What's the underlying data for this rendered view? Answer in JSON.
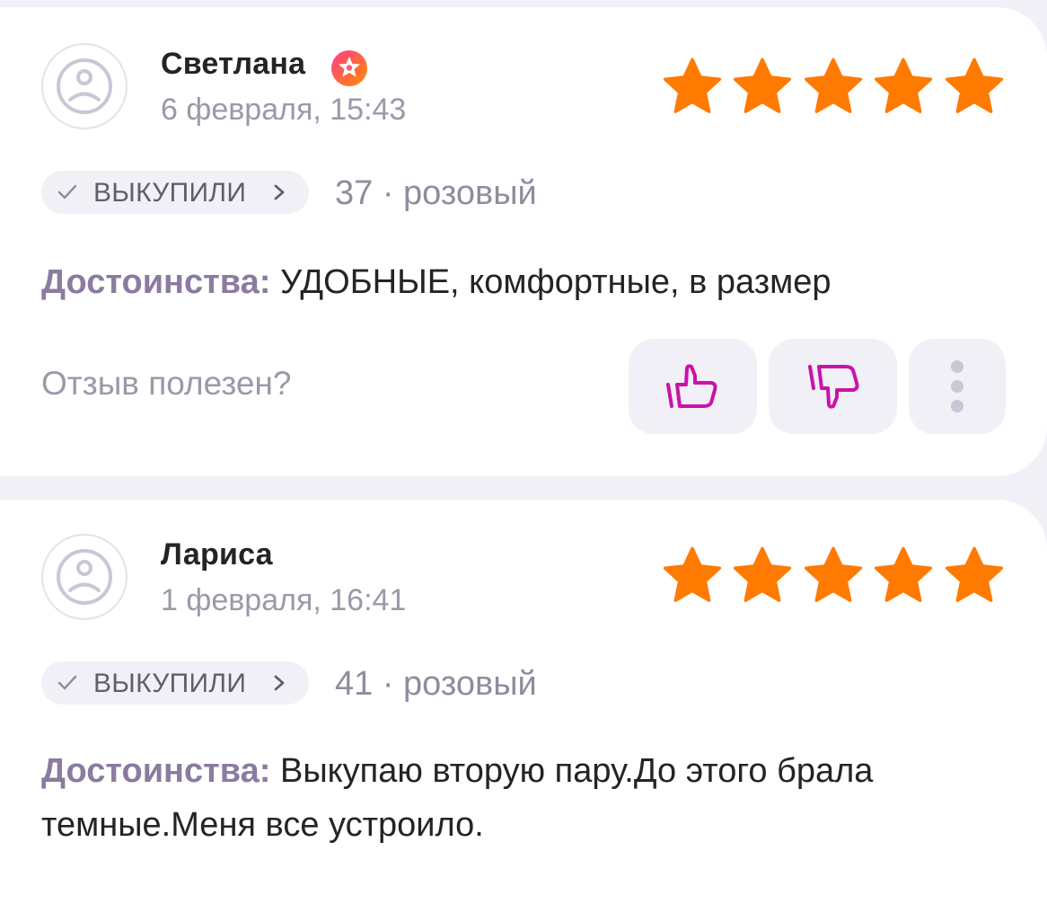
{
  "reviews": [
    {
      "author": "Светлана",
      "date": "6 февраля, 15:43",
      "rating": 5,
      "purchase_badge": "ВЫКУПИЛИ",
      "variant": "37 · розовый",
      "pros_label": "Достоинства:",
      "pros_text": "УДОБНЫЕ, комфортные, в размер",
      "helpful_question": "Отзыв полезен?"
    },
    {
      "author": "Лариса",
      "date": "1 февраля, 16:41",
      "rating": 5,
      "purchase_badge": "ВЫКУПИЛИ",
      "variant": "41 · розовый",
      "pros_label": "Достоинства:",
      "pros_text": "Выкупаю вторую пару.До этого брала темные.Меня все устроило."
    }
  ],
  "colors": {
    "star": "#ff7a00",
    "accent": "#cb11ab",
    "badge_gradient_start": "#ff3c8c",
    "badge_gradient_end": "#ff8c00",
    "background": "#f1f0f6"
  },
  "icons": {
    "avatar": "sad-face-avatar-icon",
    "author_badge": "flower-badge-icon",
    "rating": "star-icon",
    "like": "thumbs-up-icon",
    "dislike": "thumbs-down-icon",
    "more": "more-vertical-icon"
  }
}
